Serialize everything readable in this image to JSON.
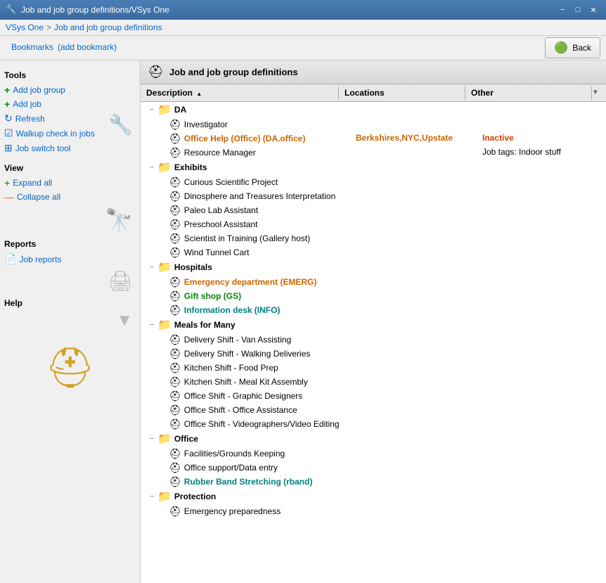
{
  "titleBar": {
    "title": "Job and job group definitions/VSys One",
    "minimizeLabel": "−",
    "maximizeLabel": "□",
    "closeLabel": "✕",
    "icon": "🔧"
  },
  "navBar": {
    "home": "VSys One",
    "separator": ">",
    "current": "Job and job group definitions"
  },
  "bookmarks": {
    "label": "Bookmarks",
    "addLabel": "(add bookmark)"
  },
  "backButton": {
    "label": "Back",
    "icon": "⊕"
  },
  "panelHeader": {
    "title": "Job and job group definitions",
    "icon": "⛑"
  },
  "tableHeader": {
    "columns": [
      "Description",
      "Locations",
      "Other"
    ]
  },
  "tools": {
    "title": "Tools",
    "items": [
      {
        "id": "add-job-group",
        "label": "Add job group",
        "icon": "+"
      },
      {
        "id": "add-job",
        "label": "Add job",
        "icon": "+"
      },
      {
        "id": "refresh",
        "label": "Refresh",
        "icon": "↻"
      },
      {
        "id": "walkup-check",
        "label": "Walkup check in jobs",
        "icon": "☑"
      },
      {
        "id": "job-switch",
        "label": "Job switch tool",
        "icon": "⊞"
      }
    ]
  },
  "view": {
    "title": "View",
    "items": [
      {
        "id": "expand-all",
        "label": "Expand all",
        "icon": "+"
      },
      {
        "id": "collapse-all",
        "label": "Collapse all",
        "icon": "−"
      }
    ]
  },
  "reports": {
    "title": "Reports",
    "items": [
      {
        "id": "job-reports",
        "label": "Job reports",
        "icon": "📄"
      }
    ]
  },
  "help": {
    "title": "Help"
  },
  "tree": {
    "groups": [
      {
        "id": "da",
        "label": "DA",
        "level": 0,
        "expanded": true,
        "jobs": [
          {
            "label": "Investigator",
            "style": "normal",
            "loc": "",
            "other": ""
          },
          {
            "label": "Office Help (Office) (DA.office)",
            "style": "orange",
            "loc": "Berkshires,NYC,Upstate",
            "other": "Inactive"
          },
          {
            "label": "Resource Manager",
            "style": "normal",
            "loc": "",
            "other": "Job tags: Indoor stuff"
          }
        ]
      },
      {
        "id": "exhibits",
        "label": "Exhibits",
        "level": 0,
        "expanded": true,
        "jobs": [
          {
            "label": "Curious Scientific Project",
            "style": "normal",
            "loc": "",
            "other": ""
          },
          {
            "label": "Dinosphere and Treasures Interpretation",
            "style": "normal",
            "loc": "",
            "other": ""
          },
          {
            "label": "Paleo Lab Assistant",
            "style": "normal",
            "loc": "",
            "other": ""
          },
          {
            "label": "Preschool Assistant",
            "style": "normal",
            "loc": "",
            "other": ""
          },
          {
            "label": "Scientist in Training (Gallery host)",
            "style": "normal",
            "loc": "",
            "other": ""
          },
          {
            "label": "Wind Tunnel Cart",
            "style": "normal",
            "loc": "",
            "other": ""
          }
        ]
      },
      {
        "id": "hospitals",
        "label": "Hospitals",
        "level": 0,
        "expanded": true,
        "jobs": [
          {
            "label": "Emergency department (EMERG)",
            "style": "orange",
            "loc": "",
            "other": ""
          },
          {
            "label": "Gift shop (GS)",
            "style": "green",
            "loc": "",
            "other": ""
          },
          {
            "label": "Information desk (INFO)",
            "style": "blue-green",
            "loc": "",
            "other": ""
          }
        ]
      },
      {
        "id": "meals-for-many",
        "label": "Meals for Many",
        "level": 0,
        "expanded": true,
        "jobs": [
          {
            "label": "Delivery Shift - Van Assisting",
            "style": "normal",
            "loc": "",
            "other": ""
          },
          {
            "label": "Delivery Shift - Walking Deliveries",
            "style": "normal",
            "loc": "",
            "other": ""
          },
          {
            "label": "Kitchen Shift - Food Prep",
            "style": "normal",
            "loc": "",
            "other": ""
          },
          {
            "label": "Kitchen Shift - Meal Kit Assembly",
            "style": "normal",
            "loc": "",
            "other": ""
          },
          {
            "label": "Office Shift - Graphic Designers",
            "style": "normal",
            "loc": "",
            "other": ""
          },
          {
            "label": "Office Shift - Office Assistance",
            "style": "normal",
            "loc": "",
            "other": ""
          },
          {
            "label": "Office Shift - Videographers/Video Editing",
            "style": "normal",
            "loc": "",
            "other": ""
          }
        ]
      },
      {
        "id": "office",
        "label": "Office",
        "level": 0,
        "expanded": true,
        "jobs": [
          {
            "label": "Facilities/Grounds Keeping",
            "style": "normal",
            "loc": "",
            "other": ""
          },
          {
            "label": "Office support/Data entry",
            "style": "normal",
            "loc": "",
            "other": ""
          },
          {
            "label": "Rubber Band Stretching (rband)",
            "style": "blue-green",
            "loc": "",
            "other": ""
          }
        ]
      },
      {
        "id": "protection",
        "label": "Protection",
        "level": 0,
        "expanded": true,
        "jobs": [
          {
            "label": "Emergency preparedness",
            "style": "normal",
            "loc": "",
            "other": ""
          }
        ]
      }
    ]
  }
}
